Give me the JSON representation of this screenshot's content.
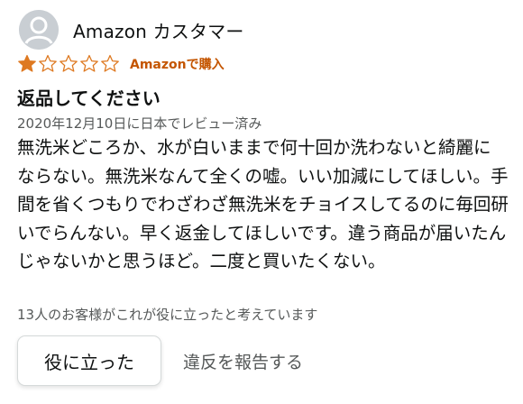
{
  "review": {
    "reviewer": {
      "name": "Amazon カスタマー",
      "avatar_icon": "default-user-avatar"
    },
    "rating": {
      "value": 1,
      "max": 5,
      "filled_color": "#de7921",
      "empty_color": "#de7921"
    },
    "verified_badge": "Amazonで購入",
    "title": "返品してください",
    "date": "2020年12月10日に日本でレビュー済み",
    "body": "無洗米どころか、水が白いままで何十回か洗わないと綺麗にならない。無洗米なんて全くの嘘。いい加減にしてほしい。手間を省くつもりでわざわざ無洗米をチョイスしてるのに毎回研いでらんない。早く返金してほしいです。違う商品が届いたんじゃないかと思うほど。二度と買いたくない。",
    "helpful_count_text": "13人のお客様がこれが役に立ったと考えています",
    "helpful_button_label": "役に立った",
    "report_label": "違反を報告する"
  },
  "colors": {
    "text": "#0f1111",
    "secondary_text": "#565959",
    "verified": "#c45500",
    "star": "#de7921"
  }
}
